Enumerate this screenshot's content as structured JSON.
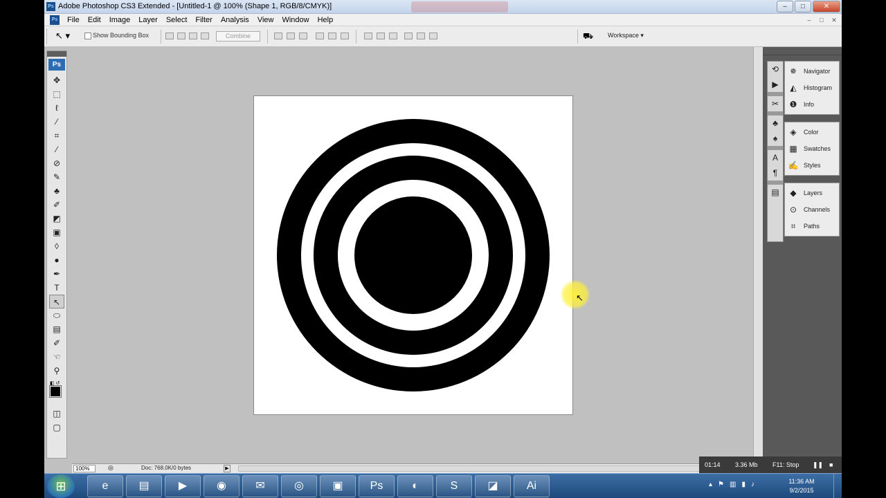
{
  "window": {
    "title": "Adobe Photoshop CS3 Extended - [Untitled-1 @ 100% (Shape 1, RGB/8/CMYK)]",
    "controls": [
      "–",
      "□",
      "✕"
    ]
  },
  "menu": {
    "app_icon": "Ps",
    "items": [
      "File",
      "Edit",
      "Image",
      "Layer",
      "Select",
      "Filter",
      "Analysis",
      "View",
      "Window",
      "Help"
    ],
    "doc_controls": [
      "–",
      "□",
      "✕"
    ]
  },
  "options": {
    "tool_icon": "path-selection-icon",
    "show_bounding_box_label": "Show Bounding Box",
    "show_bounding_box_checked": false,
    "combine_label": "Combine",
    "workspace_label": "Workspace ▾"
  },
  "toolbox": {
    "logo": "Ps",
    "tools": [
      {
        "name": "move-tool-icon",
        "glyph": "✥"
      },
      {
        "name": "marquee-tool-icon",
        "glyph": "⬚"
      },
      {
        "name": "lasso-tool-icon",
        "glyph": "ℓ"
      },
      {
        "name": "magic-wand-tool-icon",
        "glyph": "⁄"
      },
      {
        "name": "crop-tool-icon",
        "glyph": "⌗"
      },
      {
        "name": "slice-tool-icon",
        "glyph": "⁄"
      },
      {
        "name": "healing-brush-tool-icon",
        "glyph": "⊘"
      },
      {
        "name": "brush-tool-icon",
        "glyph": "✎"
      },
      {
        "name": "clone-stamp-tool-icon",
        "glyph": "♣"
      },
      {
        "name": "history-brush-tool-icon",
        "glyph": "✐"
      },
      {
        "name": "eraser-tool-icon",
        "glyph": "◩"
      },
      {
        "name": "gradient-tool-icon",
        "glyph": "▣"
      },
      {
        "name": "blur-tool-icon",
        "glyph": "◊"
      },
      {
        "name": "dodge-tool-icon",
        "glyph": "●"
      },
      {
        "name": "pen-tool-icon",
        "glyph": "✒"
      },
      {
        "name": "type-tool-icon",
        "glyph": "T"
      },
      {
        "name": "path-selection-tool-icon",
        "glyph": "↖",
        "active": true
      },
      {
        "name": "shape-tool-icon",
        "glyph": "⬭"
      },
      {
        "name": "notes-tool-icon",
        "glyph": "▤"
      },
      {
        "name": "eyedropper-tool-icon",
        "glyph": "✐"
      },
      {
        "name": "hand-tool-icon",
        "glyph": "☜"
      },
      {
        "name": "zoom-tool-icon",
        "glyph": "⚲"
      }
    ],
    "foreground_color": "#000000",
    "background_color": "#ffffff",
    "mode_tools": [
      {
        "name": "quick-mask-icon",
        "glyph": "◫"
      },
      {
        "name": "screen-mode-icon",
        "glyph": "▢"
      }
    ]
  },
  "panels": {
    "strip_icons": [
      "history-icon",
      "actions-icon",
      "tools-preset-icon",
      "brushes-icon",
      "clone-source-icon",
      "character-icon",
      "paragraph-icon",
      "layer-comps-icon"
    ],
    "groups": [
      [
        {
          "label": "Navigator",
          "icon": "navigator-icon",
          "glyph": "✵"
        },
        {
          "label": "Histogram",
          "icon": "histogram-icon",
          "glyph": "◭"
        },
        {
          "label": "Info",
          "icon": "info-icon",
          "glyph": "❶"
        }
      ],
      [
        {
          "label": "Color",
          "icon": "color-icon",
          "glyph": "◈"
        },
        {
          "label": "Swatches",
          "icon": "swatches-icon",
          "glyph": "▦"
        },
        {
          "label": "Styles",
          "icon": "styles-icon",
          "glyph": "✍"
        }
      ],
      [
        {
          "label": "Layers",
          "icon": "layers-icon",
          "glyph": "◆"
        },
        {
          "label": "Channels",
          "icon": "channels-icon",
          "glyph": "⊙"
        },
        {
          "label": "Paths",
          "icon": "paths-icon",
          "glyph": "⌗"
        }
      ]
    ]
  },
  "status": {
    "zoom": "100%",
    "doc": "Doc: 768.0K/0 bytes"
  },
  "recorder": {
    "time": "01:14",
    "size": "3.36 Mb",
    "hint": "F11: Stop"
  },
  "taskbar": {
    "apps": [
      {
        "name": "ie-icon",
        "glyph": "e"
      },
      {
        "name": "explorer-icon",
        "glyph": "▤"
      },
      {
        "name": "media-player-icon",
        "glyph": "▶"
      },
      {
        "name": "firefox-icon",
        "glyph": "◉"
      },
      {
        "name": "folder-icon",
        "glyph": "✉"
      },
      {
        "name": "chrome-icon",
        "glyph": "◎"
      },
      {
        "name": "app-icon",
        "glyph": "▣"
      },
      {
        "name": "photoshop-taskbar-icon",
        "glyph": "Ps"
      },
      {
        "name": "app2-icon",
        "glyph": "◐"
      },
      {
        "name": "skype-icon",
        "glyph": "S"
      },
      {
        "name": "app3-icon",
        "glyph": "◪"
      },
      {
        "name": "illustrator-icon",
        "glyph": "Ai"
      }
    ],
    "time": "11:36 AM",
    "date": "9/2/2015"
  },
  "canvas": {
    "shape": "concentric-rings",
    "fill": "#000000",
    "background": "#ffffff"
  }
}
